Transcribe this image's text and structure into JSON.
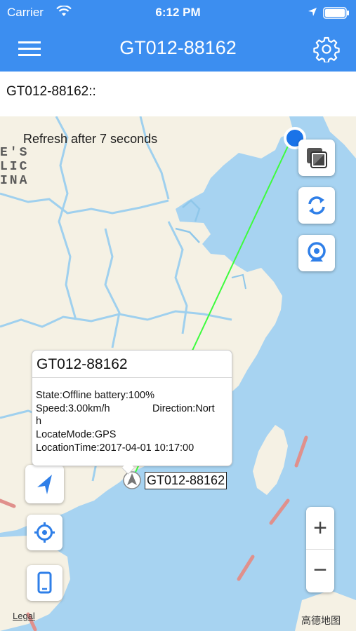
{
  "status_bar": {
    "carrier": "Carrier",
    "time": "6:12 PM"
  },
  "nav": {
    "title": "GT012-88162"
  },
  "subheader": {
    "device_text": "GT012-88162::"
  },
  "map": {
    "refresh_text": "Refresh after 7 seconds",
    "region_label_lines": [
      "E'S",
      "LIC",
      "INA"
    ],
    "legal": "Legal",
    "provider": "高德地图",
    "zoom_in": "+",
    "zoom_out": "−",
    "colors": {
      "water": "#a7d3f1",
      "land": "#f5f1e4",
      "border": "#8fc7ea",
      "track": "#3dfc3d",
      "accent": "#3c8ef0"
    }
  },
  "popup": {
    "title": "GT012-88162",
    "state_line": "State:Offline battery:100%",
    "speed": "Speed:3.00km/h",
    "direction": "Direction:Nort",
    "direction_wrap": "h",
    "locate_mode": "LocateMode:GPS",
    "location_time": "LocationTime:2017-04-01 10:17:00"
  },
  "marker": {
    "label": "GT012-88162"
  },
  "icons": {
    "menu": "hamburger-icon",
    "settings": "gear-icon",
    "layers": "map-layers-icon",
    "refresh": "refresh-icon",
    "camera": "webcam-icon",
    "navigate": "navigation-arrow-icon",
    "locate": "locate-target-icon",
    "phone": "phone-icon"
  }
}
